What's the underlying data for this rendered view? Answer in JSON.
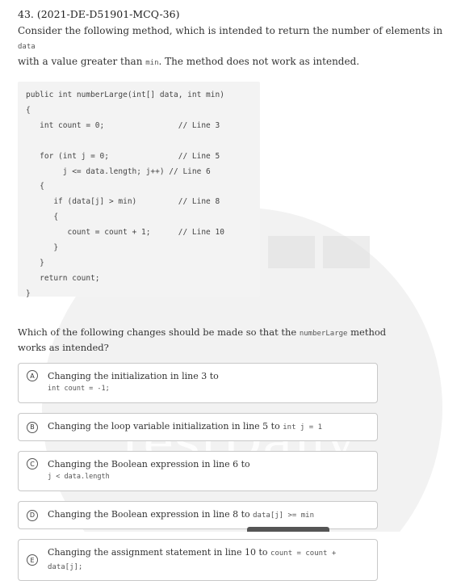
{
  "question": {
    "title": "43. (2021-DE-D51901-MCQ-36)",
    "stem_part1": "Consider the following method, which is intended to return the number of elements in ",
    "stem_code1": "data",
    "stem_part2": "with a value greater than ",
    "stem_code2": "min",
    "stem_part3": ". The method does not work as intended."
  },
  "code_lines": [
    "public int numberLarge(int[] data, int min)",
    "{",
    "   int count = 0;                // Line 3",
    "",
    "   for (int j = 0;               // Line 5",
    "        j <= data.length; j++) // Line 6",
    "   {",
    "      if (data[j] > min)         // Line 8",
    "      {",
    "         count = count + 1;      // Line 10",
    "      }",
    "   }",
    "   return count;",
    "}"
  ],
  "prompt": {
    "part1": "Which of the following changes should be made so that the ",
    "code": "numberLarge",
    "part2": " method works as intended?"
  },
  "options": [
    {
      "letter": "A",
      "text": "Changing the initialization in line 3 to",
      "code": "int count = -1;"
    },
    {
      "letter": "B",
      "text": "Changing the loop variable initialization in line 5 to ",
      "code": "int j = 1"
    },
    {
      "letter": "C",
      "text": "Changing the Boolean expression in line 6 to",
      "code": "j < data.length"
    },
    {
      "letter": "D",
      "text": "Changing the Boolean expression in line 8 to ",
      "code": "data[j] >= min"
    },
    {
      "letter": "E",
      "text": "Changing the assignment statement in line 10 to ",
      "code": "count = count + data[j];"
    }
  ],
  "watermark": {
    "text": "TestDaily",
    "color": "#e6e6e6"
  }
}
